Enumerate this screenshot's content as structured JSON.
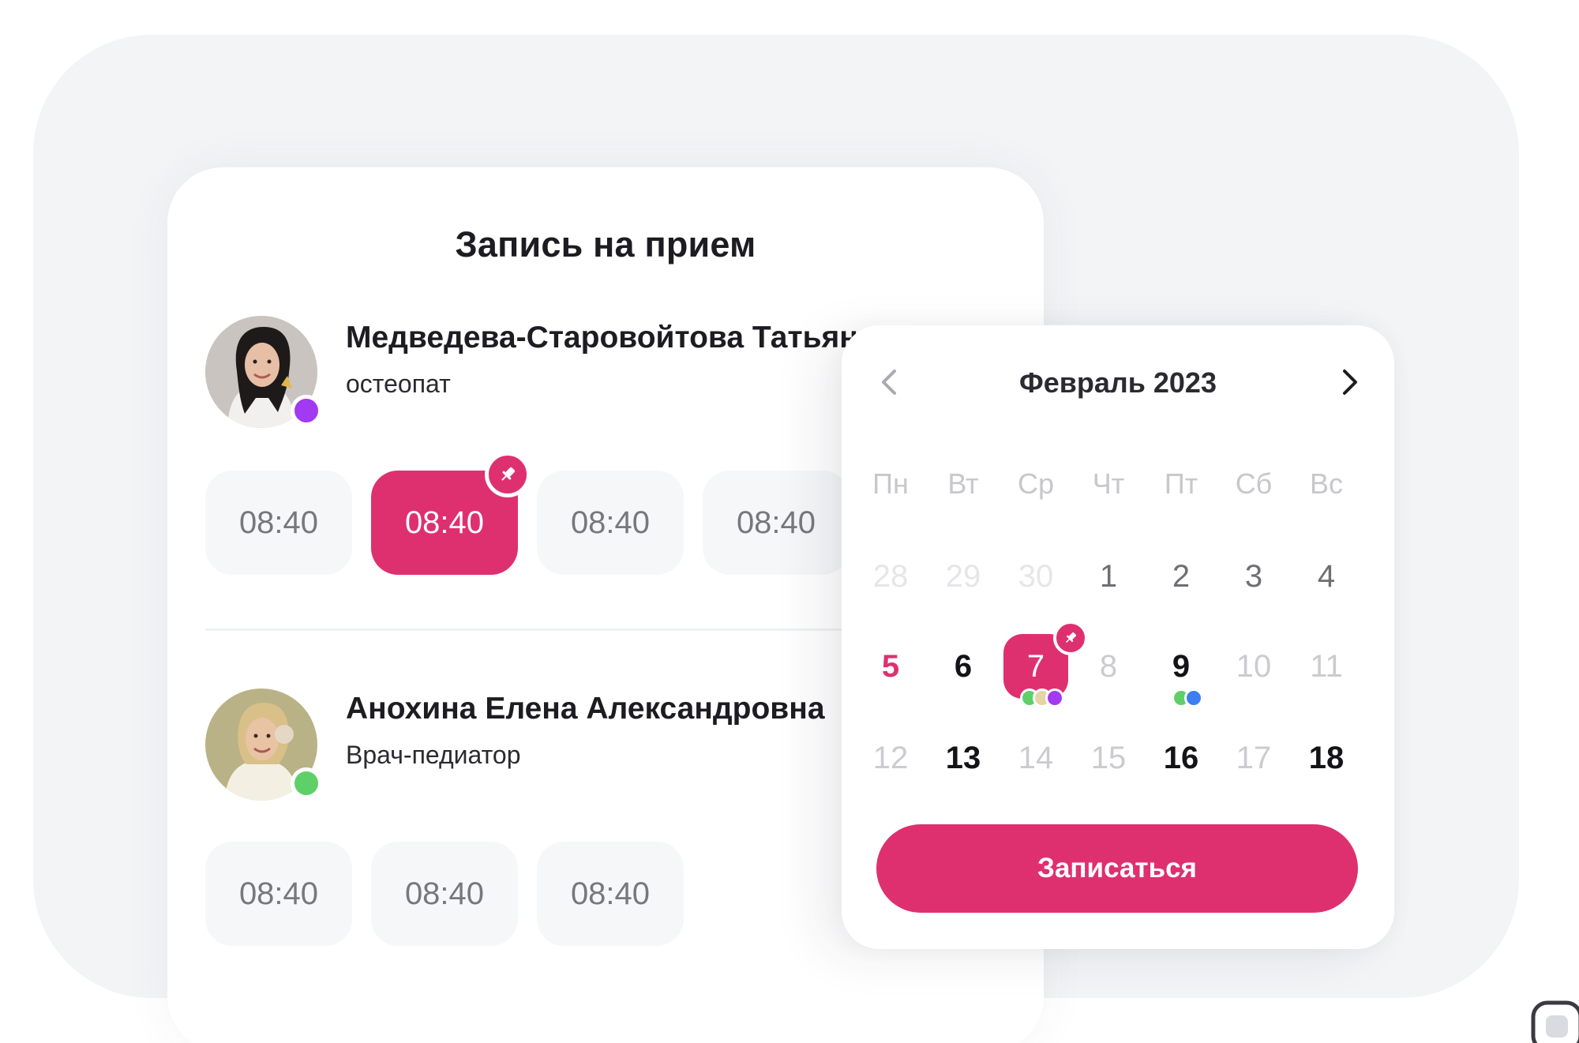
{
  "booking": {
    "title": "Запись на прием",
    "doctors": [
      {
        "name": "Медведева-Старовойтова Татьяна",
        "specialty": "остеопат",
        "status_color": "#a13af0",
        "slots": [
          "08:40",
          "08:40",
          "08:40",
          "08:40"
        ],
        "selected_slot_index": 1
      },
      {
        "name": "Анохина Елена Александровна",
        "specialty": "Врач-педиатор",
        "status_color": "#5fd068",
        "slots": [
          "08:40",
          "08:40",
          "08:40"
        ],
        "selected_slot_index": null
      }
    ]
  },
  "calendar": {
    "month_label": "Февраль 2023",
    "prev_icon": "chevron-left-icon",
    "next_icon": "chevron-right-icon",
    "weekdays": [
      "Пн",
      "Вт",
      "Ср",
      "Чт",
      "Пт",
      "Сб",
      "Вс"
    ],
    "days": [
      "28",
      "29",
      "30",
      "1",
      "2",
      "3",
      "4",
      "5",
      "6",
      "7",
      "8",
      "9",
      "10",
      "11",
      "12",
      "13",
      "14",
      "15",
      "16",
      "17",
      "18"
    ],
    "selected_day": "7",
    "today_day": "5",
    "event_dots": {
      "7": [
        "#5fd068",
        "#e6d3a6",
        "#a13af0"
      ],
      "9": [
        "#5fd068",
        "#3d7ff0"
      ]
    },
    "submit_label": "Записаться"
  },
  "colors": {
    "accent": "#de306f",
    "background": "#f3f4f6",
    "slot_bg": "#f6f7f8"
  }
}
